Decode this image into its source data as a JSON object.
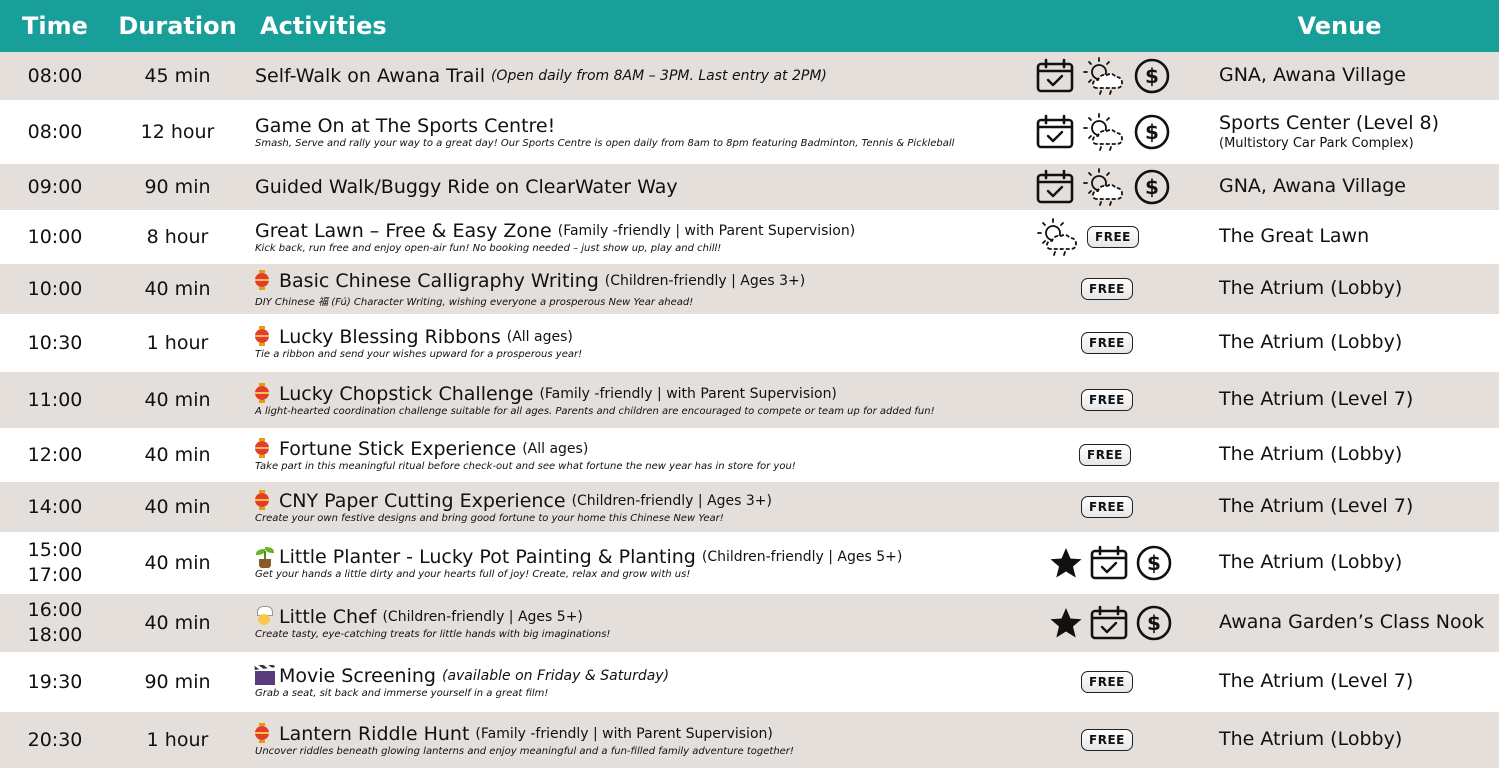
{
  "header": {
    "time": "Time",
    "duration": "Duration",
    "activities": "Activities",
    "venue": "Venue"
  },
  "colors": {
    "header_bg": "#199f9a",
    "shade_row": "#e4dfda",
    "lantern_red": "#e53b2a"
  },
  "rows": [
    {
      "time": "08:00",
      "duration": "45 min",
      "title": "Self-Walk on Awana Trail",
      "note": "(Open daily from 8AM – 3PM. Last entry at 2PM)",
      "desc": "",
      "icons": [
        "calendar-check-icon",
        "partly-sunny-icon",
        "dollar-icon"
      ],
      "venue": "GNA, Awana Village",
      "venue_sub": ""
    },
    {
      "time": "08:00",
      "duration": "12 hour",
      "title": "Game On at The Sports Centre!",
      "note": "",
      "desc": "Smash, Serve and rally your way to a great day! Our Sports Centre is open daily from 8am to 8pm featuring Badminton, Tennis & Pickleball",
      "icons": [
        "calendar-check-icon",
        "partly-sunny-icon",
        "dollar-icon"
      ],
      "venue": "Sports Center (Level 8)",
      "venue_sub": "(Multistory Car Park Complex)"
    },
    {
      "time": "09:00",
      "duration": "90 min",
      "title": "Guided Walk/Buggy Ride on ClearWater Way",
      "note": "",
      "desc": "",
      "icons": [
        "calendar-check-icon",
        "partly-sunny-icon",
        "dollar-icon"
      ],
      "venue": "GNA, Awana Village",
      "venue_sub": ""
    },
    {
      "time": "10:00",
      "duration": "8 hour",
      "title": "Great Lawn – Free & Easy Zone",
      "note": "(Family -friendly | with Parent Supervision)",
      "desc": "Kick back, run free and enjoy open-air fun! No booking needed – just show up, play and chill!",
      "icons": [
        "partly-sunny-icon",
        "free-badge"
      ],
      "venue": "The Great Lawn",
      "venue_sub": ""
    },
    {
      "time": "10:00",
      "duration": "40 min",
      "title": "Basic Chinese Calligraphy Writing",
      "note": "(Children-friendly | Ages 3+)",
      "desc": "DIY Chinese 福 (Fú) Character Writing, wishing everyone a prosperous New Year ahead!",
      "icons": [
        "free-badge"
      ],
      "emoji": "lantern",
      "venue": "The Atrium (Lobby)",
      "venue_sub": ""
    },
    {
      "time": "10:30",
      "duration": "1 hour",
      "title": "Lucky Blessing Ribbons",
      "note": "(All ages)",
      "desc": "Tie a ribbon and send your wishes upward for a prosperous year!",
      "icons": [
        "free-badge"
      ],
      "emoji": "lantern",
      "venue": "The Atrium (Lobby)",
      "venue_sub": ""
    },
    {
      "time": "11:00",
      "duration": "40 min",
      "title": "Lucky Chopstick Challenge",
      "note": "(Family -friendly | with Parent Supervision)",
      "desc": "A light-hearted coordination challenge suitable for all ages. Parents and children are encouraged to compete or team up for added fun!",
      "icons": [
        "free-badge"
      ],
      "emoji": "lantern",
      "venue": "The Atrium (Level 7)",
      "venue_sub": ""
    },
    {
      "time": "12:00",
      "duration": "40 min",
      "title": "Fortune Stick Experience",
      "note": "(All ages)",
      "desc": "Take part in this meaningful ritual before check-out and see what fortune the new year has in store for you!",
      "icons": [
        "free-badge"
      ],
      "emoji": "lantern",
      "venue": "The Atrium (Lobby)",
      "venue_sub": ""
    },
    {
      "time": "14:00",
      "duration": "40 min",
      "title": "CNY Paper Cutting Experience",
      "note": "(Children-friendly | Ages 3+)",
      "desc": "Create your own festive designs and bring good fortune to your home this Chinese New Year!",
      "icons": [
        "free-badge"
      ],
      "emoji": "lantern",
      "venue": "The Atrium (Level 7)",
      "venue_sub": ""
    },
    {
      "time": "15:00",
      "time2": "17:00",
      "duration": "40 min",
      "title": "Little Planter - Lucky Pot Painting & Planting",
      "note": "(Children-friendly | Ages 5+)",
      "desc": "Get your hands a little dirty and your hearts full of joy! Create, relax and grow with us!",
      "icons": [
        "star-icon",
        "calendar-check-icon",
        "dollar-icon"
      ],
      "emoji": "sprout",
      "venue": "The Atrium (Lobby)",
      "venue_sub": ""
    },
    {
      "time": "16:00",
      "time2": "18:00",
      "duration": "40 min",
      "title": "Little Chef",
      "note": "(Children-friendly | Ages 5+)",
      "desc": "Create tasty, eye-catching treats for little hands with big imaginations!",
      "icons": [
        "star-icon",
        "calendar-check-icon",
        "dollar-icon"
      ],
      "emoji": "chef",
      "venue": "Awana Garden’s Class Nook",
      "venue_sub": ""
    },
    {
      "time": "19:30",
      "duration": "90 min",
      "title": "Movie Screening",
      "note": "(available on Friday & Saturday)",
      "desc": "Grab a seat, sit back and immerse yourself in a great film!",
      "icons": [
        "free-badge"
      ],
      "emoji": "clapper",
      "venue": "The Atrium (Level 7)",
      "venue_sub": ""
    },
    {
      "time": "20:30",
      "duration": "1 hour",
      "title": "Lantern Riddle Hunt",
      "note": "(Family -friendly | with Parent Supervision)",
      "desc": "Uncover riddles beneath glowing lanterns and enjoy meaningful and a fun-filled family adventure together!",
      "icons": [
        "free-badge"
      ],
      "emoji": "lantern",
      "venue": "The Atrium (Lobby)",
      "venue_sub": ""
    }
  ],
  "free_label": "FREE"
}
